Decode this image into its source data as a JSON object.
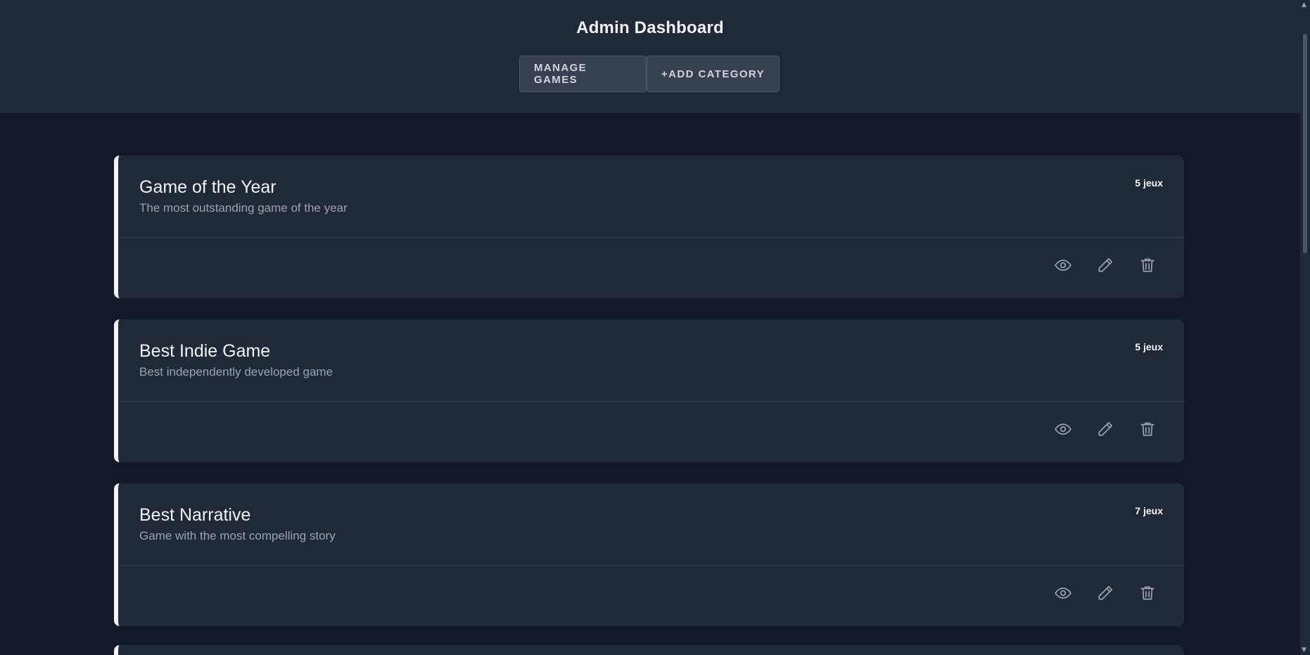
{
  "header": {
    "title": "Admin Dashboard",
    "buttons": {
      "manage_games": "MANAGE GAMES",
      "add_category": "+ADD CATEGORY"
    }
  },
  "categories": [
    {
      "name": "Game of the Year",
      "description": "The most outstanding game of the year",
      "count": "5 jeux"
    },
    {
      "name": "Best Indie Game",
      "description": "Best independently developed game",
      "count": "5 jeux"
    },
    {
      "name": "Best Narrative",
      "description": "Game with the most compelling story",
      "count": "7 jeux"
    }
  ],
  "icons": {
    "view": "eye-icon",
    "edit": "pencil-icon",
    "delete": "trash-icon"
  },
  "colors": {
    "background": "#111827",
    "card": "#1f2937",
    "accent_border": "#f3f4f6",
    "button": "#374151"
  }
}
